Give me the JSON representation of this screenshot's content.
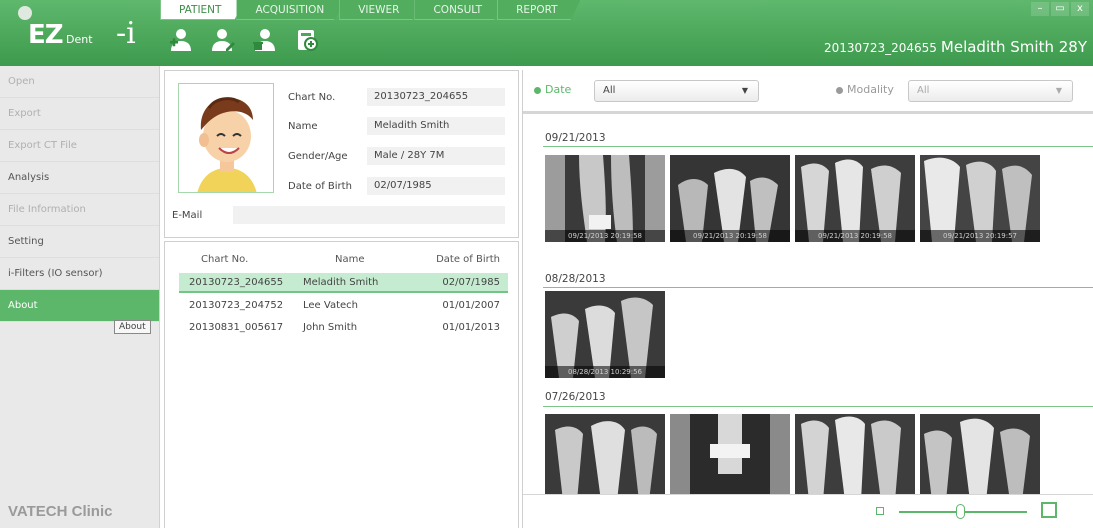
{
  "app": {
    "logo_ez": "EZ",
    "logo_dent": "Dent",
    "logo_i": "-i"
  },
  "tabs": [
    "PATIENT",
    "ACQUISITION",
    "VIEWER",
    "CONSULT",
    "REPORT"
  ],
  "toolbar": [
    "add-patient-icon",
    "edit-patient-icon",
    "delete-patient-icon",
    "import-image-icon"
  ],
  "window_controls": [
    "–",
    "▭",
    "x"
  ],
  "header": {
    "chart_no": "20130723_204655",
    "patient": "Meladith Smith 28Y"
  },
  "sidebar": {
    "items": [
      {
        "label": "Open",
        "enabled": false
      },
      {
        "label": "Export",
        "enabled": false
      },
      {
        "label": "Export CT File",
        "enabled": false
      },
      {
        "label": "Analysis",
        "enabled": true
      },
      {
        "label": "File Information",
        "enabled": false
      },
      {
        "label": "Setting",
        "enabled": true
      },
      {
        "label": "i-Filters (IO sensor)",
        "enabled": true
      },
      {
        "label": "About",
        "enabled": true,
        "selected": true
      }
    ],
    "about_tooltip": "About",
    "clinic": "VATECH Clinic"
  },
  "patient_info": {
    "labels": {
      "chart_no": "Chart No.",
      "name": "Name",
      "gender_age": "Gender/Age",
      "dob": "Date of Birth",
      "email": "E-Mail"
    },
    "values": {
      "chart_no": "20130723_204655",
      "name": "Meladith Smith",
      "gender_age": "Male / 28Y 7M",
      "dob": "02/07/1985",
      "email": ""
    }
  },
  "patient_list": {
    "columns": [
      "Chart No.",
      "Name",
      "Date of Birth"
    ],
    "rows": [
      {
        "chart_no": "20130723_204655",
        "name": "Meladith Smith",
        "dob": "02/07/1985",
        "selected": true
      },
      {
        "chart_no": "20130723_204752",
        "name": "Lee Vatech",
        "dob": "01/01/2007",
        "selected": false
      },
      {
        "chart_no": "20130831_005617",
        "name": "John Smith",
        "dob": "01/01/2013",
        "selected": false
      }
    ]
  },
  "filters": {
    "date_label": "Date",
    "date_value": "All",
    "modality_label": "Modality",
    "modality_value": "All"
  },
  "image_groups": [
    {
      "date": "09/21/2013",
      "captions": [
        "09/21/2013 20:19:58",
        "09/21/2013 20:19:58",
        "09/21/2013 20:19:58",
        "09/21/2013 20:19:57"
      ]
    },
    {
      "date": "08/28/2013",
      "captions": [
        "08/28/2013 10:29:56"
      ]
    },
    {
      "date": "07/26/2013",
      "captions": [
        "",
        "",
        "",
        ""
      ]
    }
  ],
  "colors": {
    "accent": "#5db76a",
    "header": "#4aa85a",
    "selected_row": "#c5ecd0"
  }
}
